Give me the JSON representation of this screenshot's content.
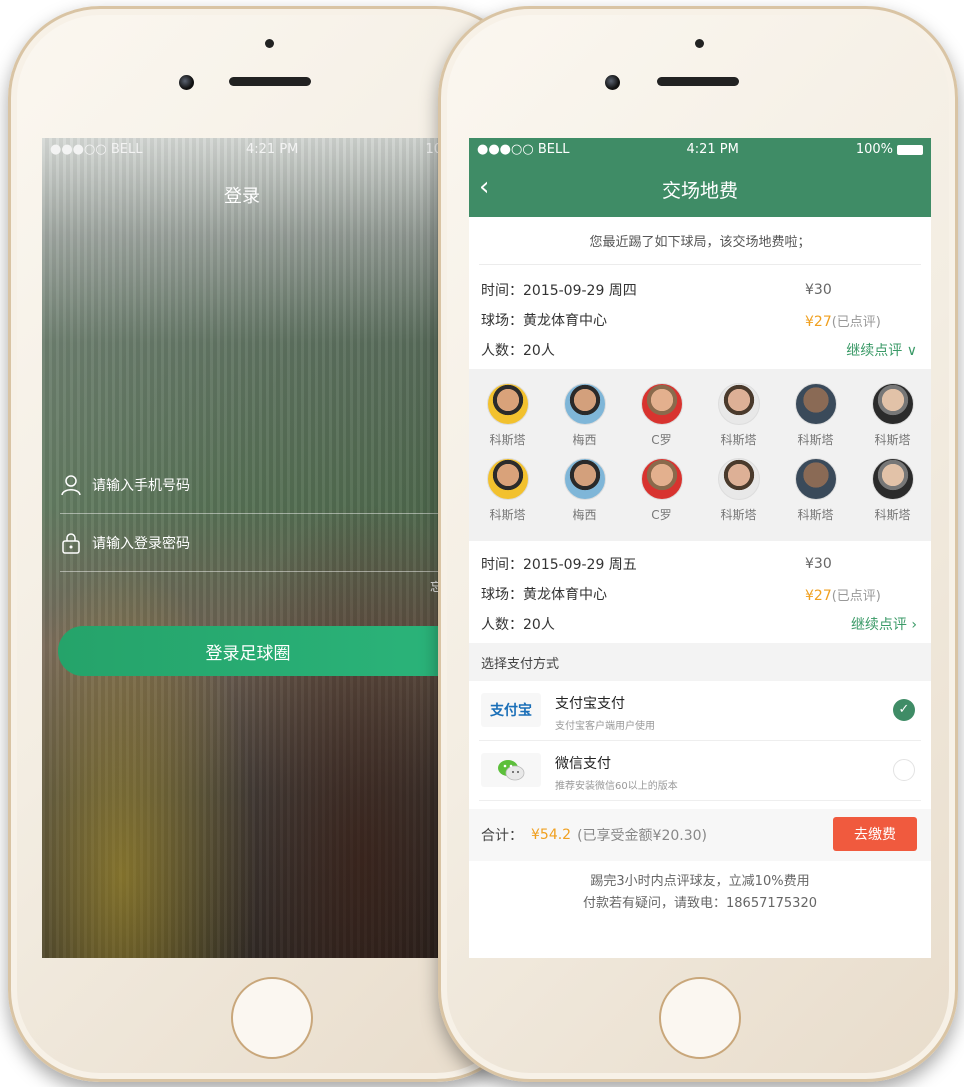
{
  "left": {
    "status": {
      "carrier": "●●●○○ BELL",
      "time": "4:21 PM",
      "battery": "10"
    },
    "title": "登录",
    "phone_placeholder": "请输入手机号码",
    "password_placeholder": "请输入登录密码",
    "forgot": "忘",
    "login_button": "登录足球圈"
  },
  "right": {
    "status": {
      "carrier": "●●●○○ BELL",
      "time": "4:21 PM",
      "battery": "100%"
    },
    "title": "交场地费",
    "back": "‹",
    "notice": "您最近踢了如下球局，该交场地费啦；",
    "matches": [
      {
        "time": "时间：2015-09-29  周四",
        "venue": "球场：黄龙体育中心",
        "people": "人数：20人",
        "price": "¥30",
        "paid": "¥27",
        "paid_note": "(已点评)",
        "more": "继续点评 ∨"
      },
      {
        "time": "时间：2015-09-29  周五",
        "venue": "球场：黄龙体育中心",
        "people": "人数：20人",
        "price": "¥30",
        "paid": "¥27",
        "paid_note": "(已点评)",
        "more": "继续点评 ›"
      }
    ],
    "players": [
      [
        "科斯塔",
        "梅西",
        "C罗",
        "科斯塔",
        "科斯塔",
        "科斯塔"
      ],
      [
        "科斯塔",
        "梅西",
        "C罗",
        "科斯塔",
        "科斯塔",
        "科斯塔"
      ]
    ],
    "pay_header": "选择支付方式",
    "pay_options": [
      {
        "logo": "支付宝",
        "title": "支付宝支付",
        "sub": "支付宝客户端用户使用"
      },
      {
        "logo": "",
        "title": "微信支付",
        "sub": "推荐安装微信60以上的版本"
      }
    ],
    "total_label": "合计：",
    "total_amount": "¥54.2",
    "discount": "(已享受金额¥20.30)",
    "pay_button": "去缴费",
    "footer_line1": "踢完3小时内点评球友，立减10%费用",
    "footer_line2": "付款若有疑问，请致电：18657175320"
  },
  "colors": {
    "brand_green": "#3f8c66",
    "orange": "#f0a020",
    "pay_red": "#f05a3e"
  }
}
